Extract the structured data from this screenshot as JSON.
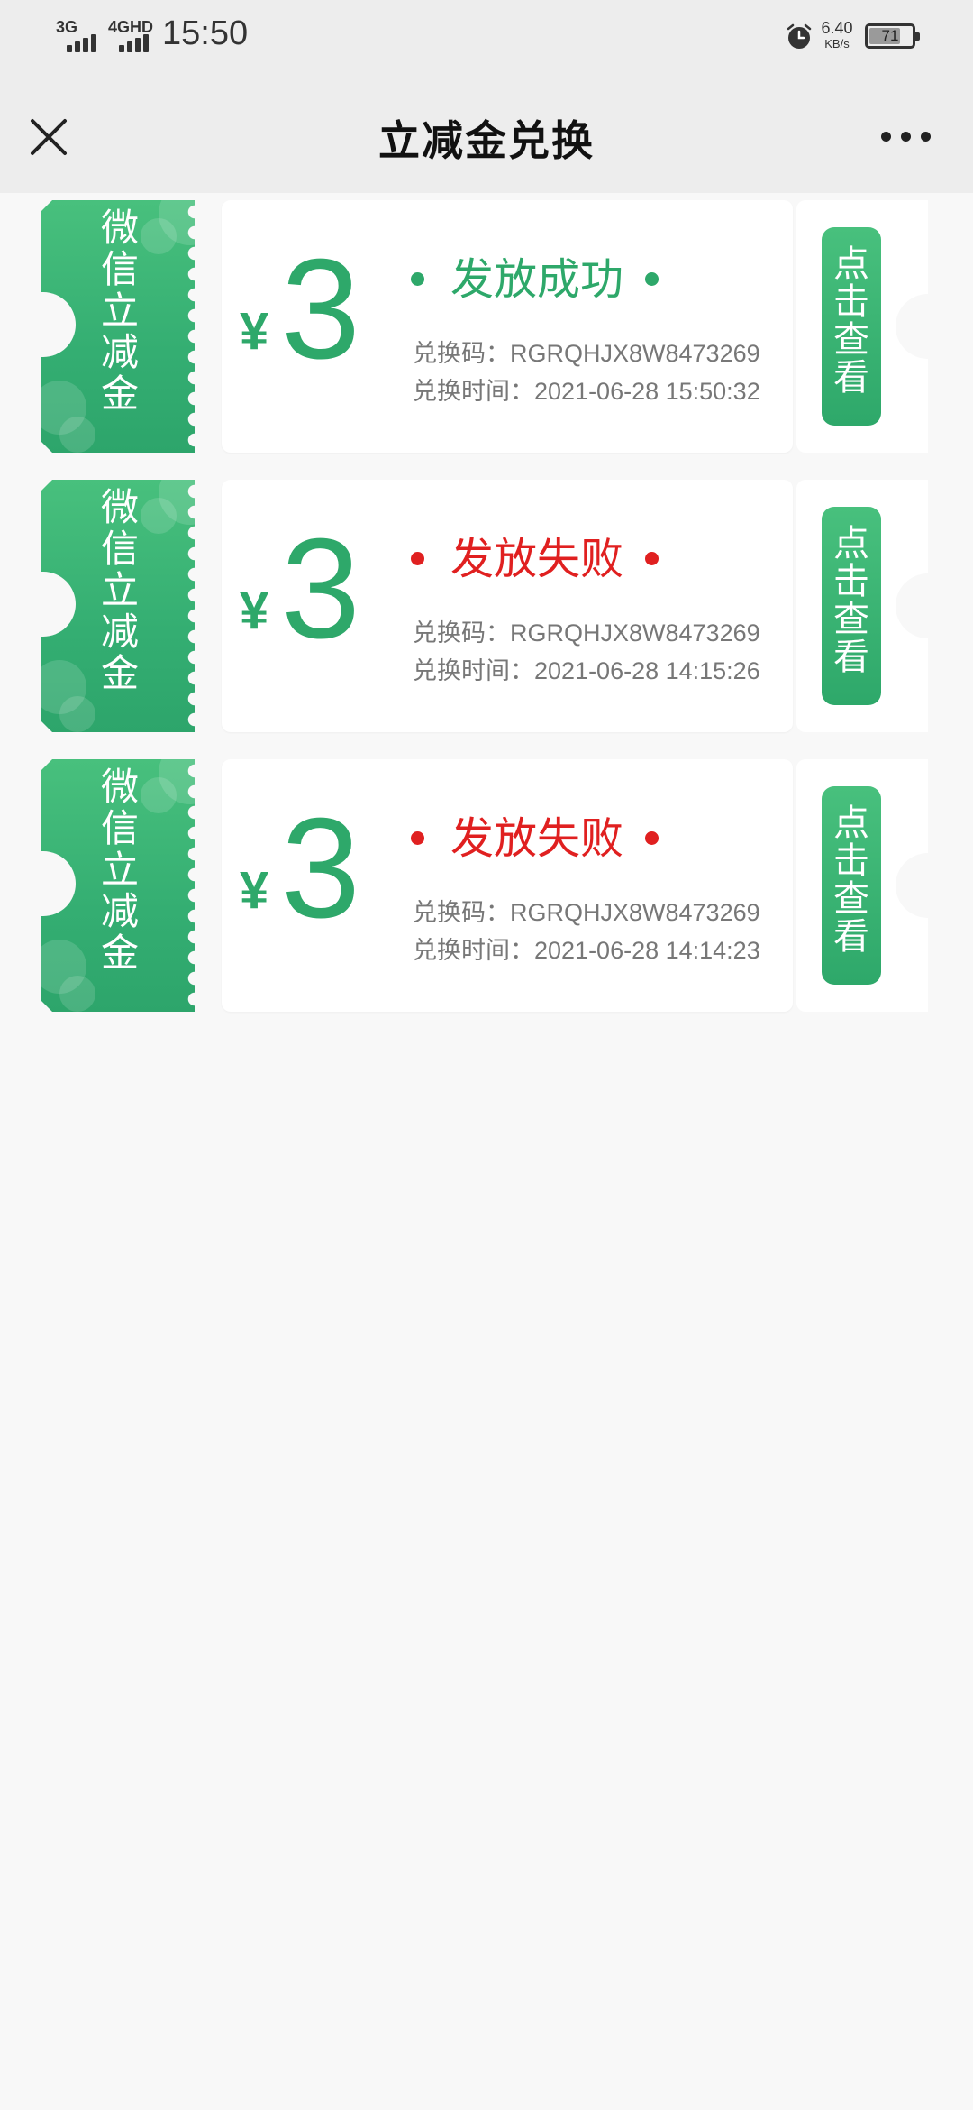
{
  "status_bar": {
    "signal1_label": "3G",
    "signal2_label": "4GHD",
    "time": "15:50",
    "speed_value": "6.40",
    "speed_unit": "KB/s",
    "battery": "71",
    "icons": [
      "signal-icon",
      "alarm-icon",
      "battery-icon"
    ]
  },
  "header": {
    "title": "立减金兑换",
    "close_icon": "close-icon",
    "more_icon": "more-icon"
  },
  "colors": {
    "accent_green": "#2ea86a",
    "success_green": "#2ea86a",
    "fail_red": "#e02020",
    "background": "#f8f8f8"
  },
  "coupons": [
    {
      "stub_label": "微信立减金",
      "currency": "¥",
      "amount": "3",
      "status": "发放成功",
      "status_type": "success",
      "code_line": "兑换码：RGRQHJX8W8473269",
      "time_line": "兑换时间：2021-06-28 15:50:32",
      "action": "点击查看"
    },
    {
      "stub_label": "微信立减金",
      "currency": "¥",
      "amount": "3",
      "status": "发放失败",
      "status_type": "fail",
      "code_line": "兑换码：RGRQHJX8W8473269",
      "time_line": "兑换时间：2021-06-28 14:15:26",
      "action": "点击查看"
    },
    {
      "stub_label": "微信立减金",
      "currency": "¥",
      "amount": "3",
      "status": "发放失败",
      "status_type": "fail",
      "code_line": "兑换码：RGRQHJX8W8473269",
      "time_line": "兑换时间：2021-06-28 14:14:23",
      "action": "点击查看"
    }
  ]
}
